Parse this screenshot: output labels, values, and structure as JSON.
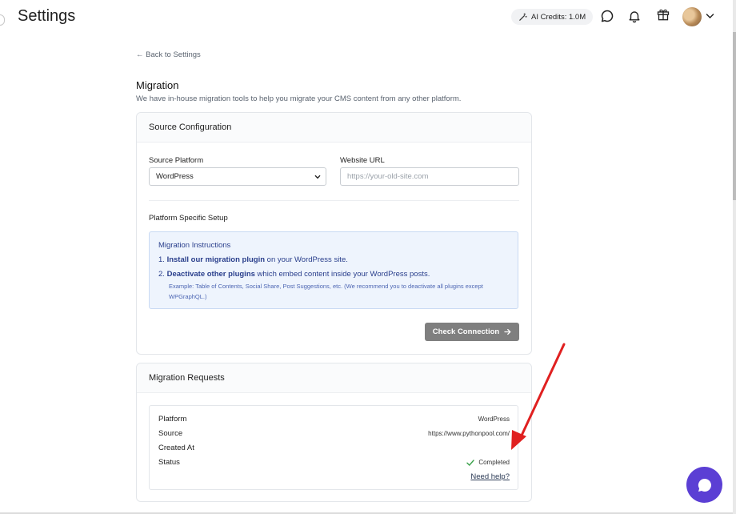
{
  "header": {
    "title": "Settings",
    "credits_label": "AI Credits: 1.0M",
    "icons": [
      "magic-wand-icon",
      "chat-icon",
      "bell-icon",
      "gift-icon",
      "avatar",
      "chevron-down-icon"
    ]
  },
  "nav": {
    "back_label": "← Back to Settings"
  },
  "migration": {
    "title": "Migration",
    "description": "We have in-house migration tools to help you migrate your CMS content from any other platform."
  },
  "source_config": {
    "title": "Source Configuration",
    "platform_label": "Source Platform",
    "platform_value": "WordPress",
    "url_label": "Website URL",
    "url_placeholder": "https://your-old-site.com",
    "setup_label": "Platform Specific Setup",
    "instructions": {
      "title": "Migration Instructions",
      "step1_num": "1.",
      "step1_bold": "Install our migration plugin",
      "step1_rest": " on your WordPress site.",
      "step2_num": "2.",
      "step2_bold": "Deactivate other plugins",
      "step2_rest": " which embed content inside your WordPress posts.",
      "step2_note": "Example: Table of Contents, Social Share, Post Suggestions, etc. (We recommend you to deactivate all plugins except WPGraphQL.)"
    },
    "check_button": "Check Connection"
  },
  "requests": {
    "title": "Migration Requests",
    "rows": [
      {
        "key": "Platform",
        "value": "WordPress"
      },
      {
        "key": "Source",
        "value": "https://www.pythonpool.com/"
      },
      {
        "key": "Created At",
        "value": ""
      },
      {
        "key": "Status",
        "value": "Completed"
      }
    ],
    "help_label": "Need help?"
  },
  "colors": {
    "accent": "#5b3fd4",
    "button_gray": "#7f7f7f",
    "info_bg": "#eef4fd",
    "status_green": "#3aa14a",
    "annotation_red": "#e02020"
  }
}
